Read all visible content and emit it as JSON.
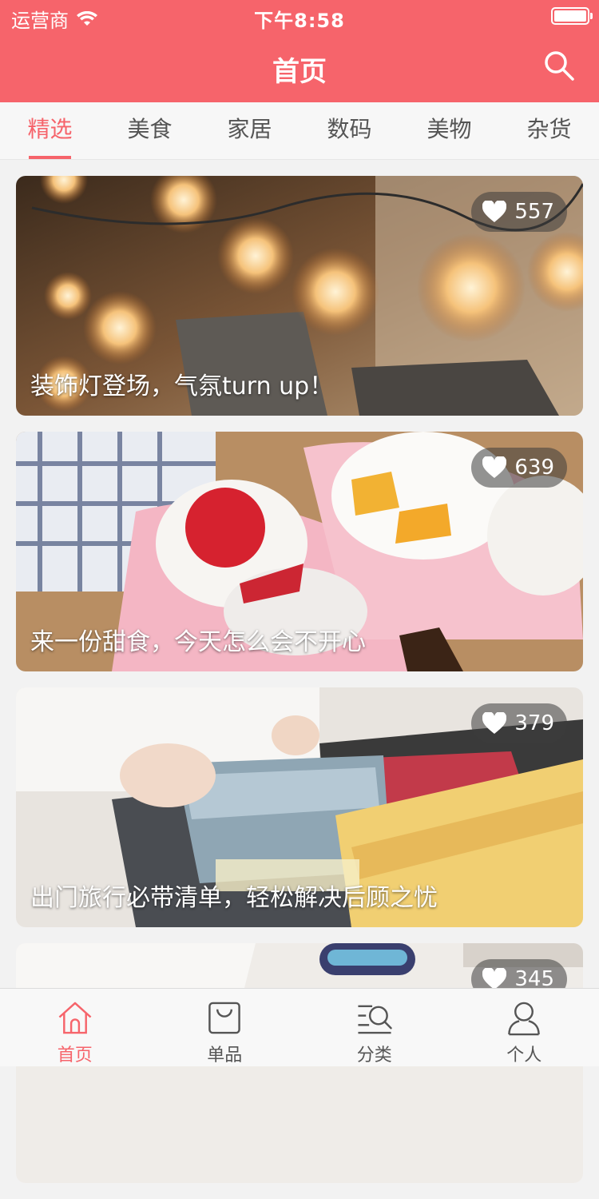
{
  "status_bar": {
    "carrier": "运营商",
    "time": "下午8:58"
  },
  "nav": {
    "title": "首页"
  },
  "tabs": [
    {
      "label": "精选",
      "active": true
    },
    {
      "label": "美食",
      "active": false
    },
    {
      "label": "家居",
      "active": false
    },
    {
      "label": "数码",
      "active": false
    },
    {
      "label": "美物",
      "active": false
    },
    {
      "label": "杂货",
      "active": false
    }
  ],
  "cards": [
    {
      "likes": "557",
      "caption": "装饰灯登场，气氛turn up！"
    },
    {
      "likes": "639",
      "caption": "来一份甜食，今天怎么会不开心"
    },
    {
      "likes": "379",
      "caption": "出门旅行必带清单，轻松解决后顾之忧"
    },
    {
      "likes": "345",
      "caption": ""
    }
  ],
  "tabbar": [
    {
      "label": "首页",
      "icon": "home-icon",
      "active": true
    },
    {
      "label": "单品",
      "icon": "bag-icon",
      "active": false
    },
    {
      "label": "分类",
      "icon": "category-search-icon",
      "active": false
    },
    {
      "label": "个人",
      "icon": "person-icon",
      "active": false
    }
  ],
  "colors": {
    "brand": "#f6646b"
  }
}
